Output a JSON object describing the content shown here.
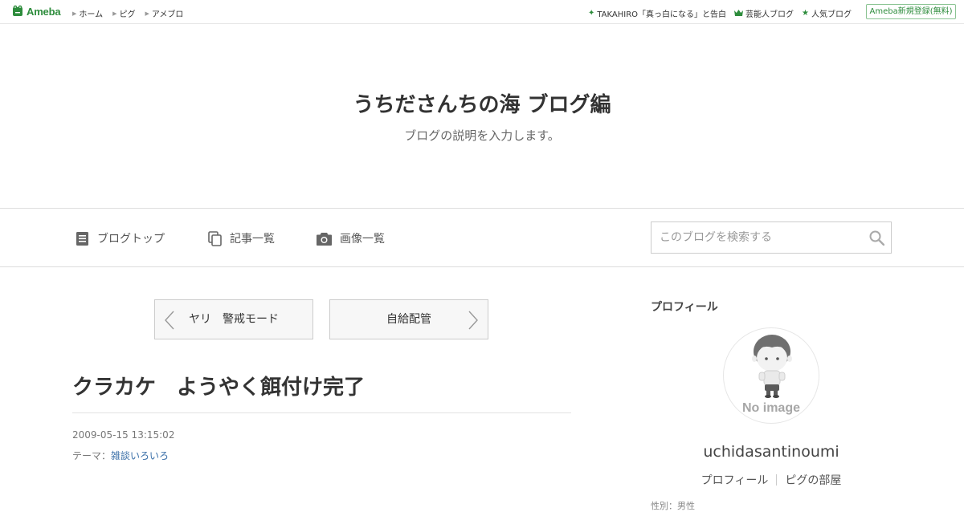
{
  "topbar": {
    "logo_text": "Ameba",
    "left_links": [
      "ホーム",
      "ピグ",
      "アメブロ"
    ],
    "right_links": [
      {
        "icon": "sparkle-icon",
        "label": "TAKAHIRO「真っ白になる」と告白"
      },
      {
        "icon": "crown-icon",
        "label": "芸能人ブログ"
      },
      {
        "icon": "star-icon",
        "label": "人気ブログ"
      }
    ],
    "register_label": "Ameba新規登録(無料)"
  },
  "header": {
    "title": "うちださんちの海 ブログ編",
    "description": "ブログの説明を入力します。"
  },
  "nav": {
    "blog_top": "ブログトップ",
    "entry_list": "記事一覧",
    "image_list": "画像一覧",
    "search_placeholder": "このブログを検索する"
  },
  "pager": {
    "prev_label": "ヤリ　警戒モード",
    "next_label": "自給配管"
  },
  "entry": {
    "title": "クラカケ　ようやく餌付け完了",
    "date": "2009-05-15 13:15:02",
    "theme_prefix": "テーマ：",
    "theme_link": "雑談いろいろ"
  },
  "sidebar": {
    "heading": "プロフィール",
    "avatar_text": "No image",
    "username": "uchidasantinoumi",
    "profile_link": "プロフィール",
    "pigg_link": "ピグの部屋",
    "cut_text": "性別：男性"
  },
  "colors": {
    "brand_green": "#2d8c3c",
    "link_blue": "#3a6fa8"
  }
}
